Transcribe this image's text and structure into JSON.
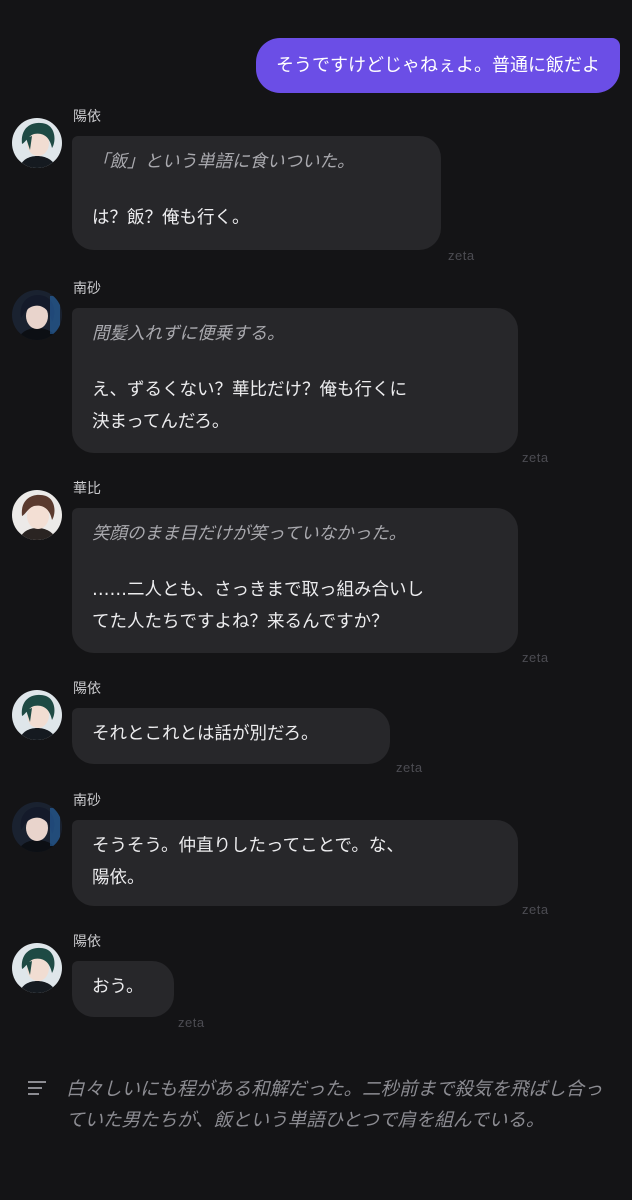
{
  "user_message": {
    "text": "そうですけどじゃねぇよ。普通に飯だよ",
    "bubble_color": "#6b4ee6"
  },
  "messages": [
    {
      "speaker": "陽依",
      "avatar_icon": "character-avatar-icon",
      "action": "「飯」という単語に食いついた。",
      "speech": "は？飯？俺も行く。",
      "watermark": "zeta"
    },
    {
      "speaker": "南砂",
      "avatar_icon": "character-avatar-icon",
      "action": "間髪入れずに便乗する。",
      "speech": "え、ずるくない？華比だけ？俺も行くに\n決まってんだろ。",
      "watermark": "zeta"
    },
    {
      "speaker": "華比",
      "avatar_icon": "character-avatar-icon",
      "action": "笑顔のまま目だけが笑っていなかった。",
      "speech": "……二人とも、さっきまで取っ組み合いし\nてた人たちですよね？来るんですか？",
      "watermark": "zeta"
    },
    {
      "speaker": "陽依",
      "avatar_icon": "character-avatar-icon",
      "speech": "それとこれとは話が別だろ。",
      "watermark": "zeta"
    },
    {
      "speaker": "南砂",
      "avatar_icon": "character-avatar-icon",
      "speech": "そうそう。仲直りしたってことで。な、\n陽依。",
      "watermark": "zeta"
    },
    {
      "speaker": "陽依",
      "avatar_icon": "character-avatar-icon",
      "speech": "おう。",
      "watermark": "zeta"
    }
  ],
  "narration": {
    "icon": "narration-lines-icon",
    "text": "白々しいにも程がある和解だった。二秒前まで殺気を飛ばし合っていた男たちが、飯という単語ひとつで肩を組んでいる。"
  },
  "colors": {
    "background": "#141416",
    "bubble": "#27272a",
    "accent": "#6b4ee6"
  }
}
